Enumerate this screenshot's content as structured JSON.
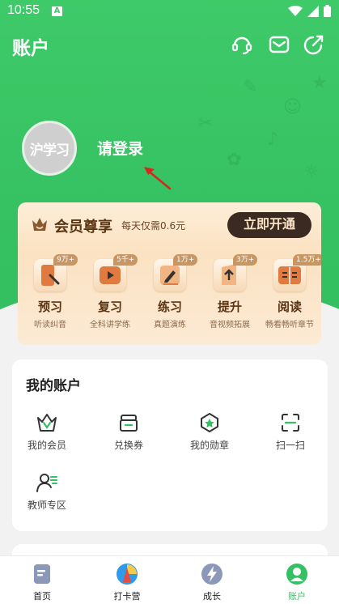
{
  "status_bar": {
    "time": "10:55",
    "notif": "A"
  },
  "header": {
    "title": "账户"
  },
  "profile": {
    "avatar_text": "沪学习",
    "login_label": "请登录"
  },
  "vip": {
    "title": "会员尊享",
    "subtitle": "每天仅需0.6元",
    "button": "立即开通",
    "items": [
      {
        "name": "预习",
        "desc": "听读纠音",
        "badge": "9万+"
      },
      {
        "name": "复习",
        "desc": "全科讲学练",
        "badge": "5千+"
      },
      {
        "name": "练习",
        "desc": "真题演练",
        "badge": "1万+"
      },
      {
        "name": "提升",
        "desc": "音视频拓展",
        "badge": "3万+"
      },
      {
        "name": "阅读",
        "desc": "畅看畅听章节",
        "badge": "1.5万+"
      }
    ]
  },
  "account": {
    "title": "我的账户",
    "items": [
      {
        "label": "我的会员",
        "icon": "vip-crown-icon"
      },
      {
        "label": "兑换券",
        "icon": "coupon-icon"
      },
      {
        "label": "我的勋章",
        "icon": "medal-icon"
      },
      {
        "label": "扫一扫",
        "icon": "scan-icon"
      },
      {
        "label": "教师专区",
        "icon": "teacher-icon"
      }
    ]
  },
  "tabs": [
    {
      "label": "首页"
    },
    {
      "label": "打卡营"
    },
    {
      "label": "成长"
    },
    {
      "label": "账户"
    }
  ],
  "colors": {
    "accent": "#35c063",
    "vip_dark": "#3b2a22"
  }
}
